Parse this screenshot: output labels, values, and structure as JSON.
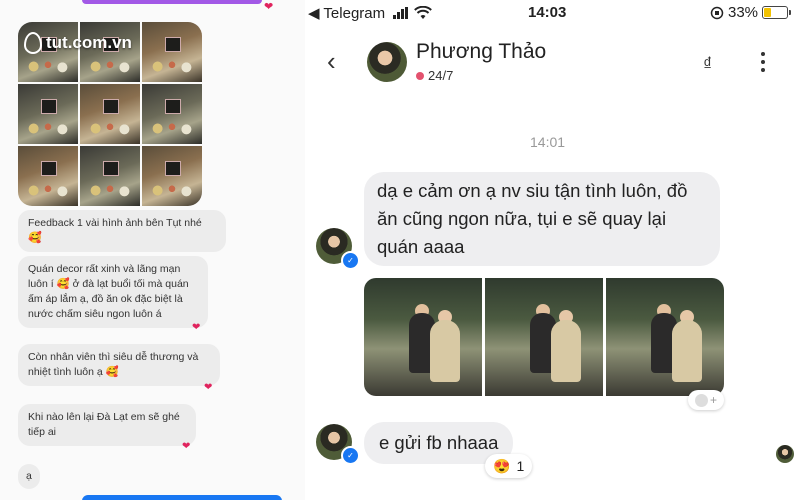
{
  "left_panel": {
    "watermark": "tut.com.vn",
    "messages": [
      {
        "text": "Feedback 1 vài hình ảnh bên Tụt nhé",
        "emoji": "🥰"
      },
      {
        "text": "Quán decor rất xinh và lãng mạn luôn í 🥰 ở đà lạt buổi tối mà quán ấm áp lắm ạ, đồ ăn ok đặc biệt là nước chấm siêu ngon luôn á"
      },
      {
        "text": "Còn nhân viên thì siêu dễ thương và nhiệt tình luôn ạ 🥰"
      },
      {
        "text": "Khi nào lên lại Đà Lạt em sẽ ghé tiếp ai"
      },
      {
        "text": "ạ"
      }
    ],
    "heart": "❤"
  },
  "status_bar": {
    "back_app": "◀ Telegram",
    "time": "14:03",
    "battery": "33%"
  },
  "header": {
    "name": "Phương Thảo",
    "status": "24/7",
    "icon_char": "₫"
  },
  "conversation": {
    "time_separator": "14:01",
    "message1": "dạ e cảm ơn ạ nv siu tận tình luôn, đồ ăn cũng ngon nữa, tụi e sẽ quay lại quán aaaa",
    "message2": "e gửi fb nhaaa",
    "reaction_emoji": "😍",
    "reaction_count": "1",
    "add_reaction": "+"
  },
  "colors": {
    "accent_blue": "#1877f2",
    "heart_red": "#e0245e",
    "online_dot": "#e3526e",
    "bubble_gray": "#eeeef0"
  }
}
